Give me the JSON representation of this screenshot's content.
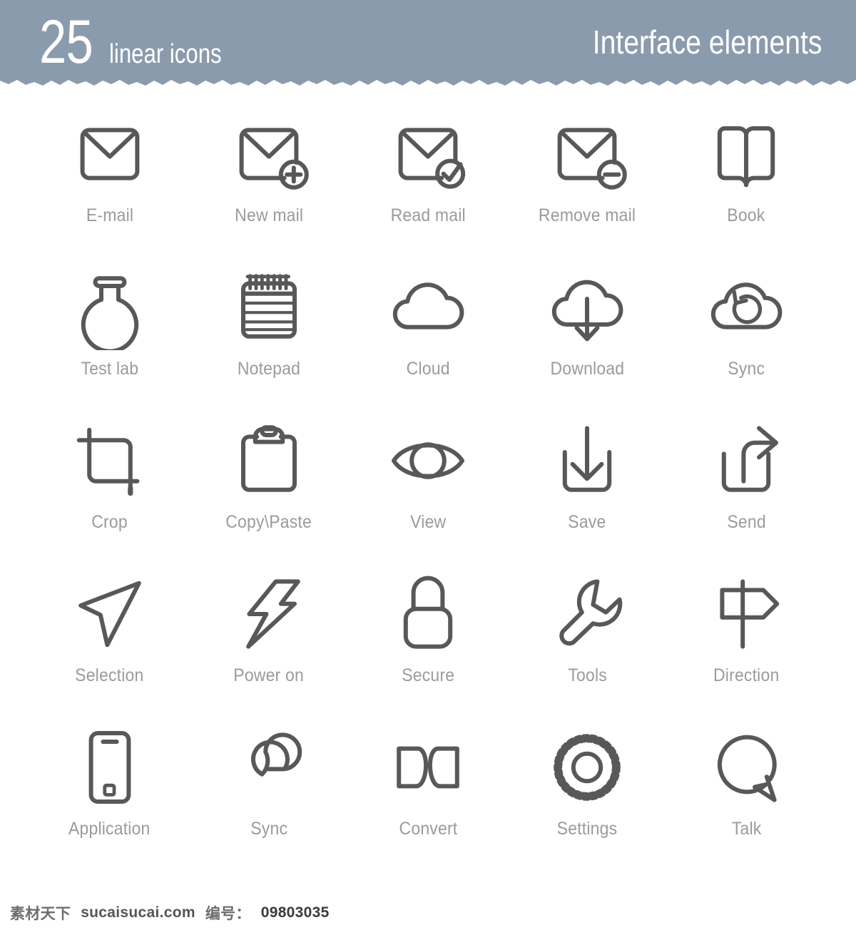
{
  "header": {
    "count": "25",
    "subtitle": "linear icons",
    "category": "Interface elements",
    "bg_color": "#8b9bae",
    "text_color": "#ffffff"
  },
  "style": {
    "icon_stroke_color": "#58585a",
    "label_color": "#9b9b9b",
    "page_background": "#ffffff"
  },
  "icons": [
    {
      "icon": "envelope-icon",
      "label": "E-mail"
    },
    {
      "icon": "envelope-plus-icon",
      "label": "New mail"
    },
    {
      "icon": "envelope-check-icon",
      "label": "Read mail"
    },
    {
      "icon": "envelope-minus-icon",
      "label": "Remove mail"
    },
    {
      "icon": "open-book-icon",
      "label": "Book"
    },
    {
      "icon": "flask-icon",
      "label": "Test lab"
    },
    {
      "icon": "notepad-icon",
      "label": "Notepad"
    },
    {
      "icon": "cloud-icon",
      "label": "Cloud"
    },
    {
      "icon": "cloud-download-icon",
      "label": "Download"
    },
    {
      "icon": "cloud-sync-icon",
      "label": "Sync"
    },
    {
      "icon": "crop-icon",
      "label": "Crop"
    },
    {
      "icon": "clipboard-icon",
      "label": "Copy\\Paste"
    },
    {
      "icon": "eye-icon",
      "label": "View"
    },
    {
      "icon": "save-tray-arrow-icon",
      "label": "Save"
    },
    {
      "icon": "send-share-icon",
      "label": "Send"
    },
    {
      "icon": "cursor-arrow-icon",
      "label": "Selection"
    },
    {
      "icon": "lightning-bolt-icon",
      "label": "Power on"
    },
    {
      "icon": "padlock-icon",
      "label": "Secure"
    },
    {
      "icon": "wrench-icon",
      "label": "Tools"
    },
    {
      "icon": "signpost-icon",
      "label": "Direction"
    },
    {
      "icon": "smartphone-icon",
      "label": "Application"
    },
    {
      "icon": "infinity-loop-icon",
      "label": "Sync"
    },
    {
      "icon": "convert-bowtie-icon",
      "label": "Convert"
    },
    {
      "icon": "gear-icon",
      "label": "Settings"
    },
    {
      "icon": "speech-bubble-icon",
      "label": "Talk"
    }
  ],
  "footer": {
    "site_name": "素材天下",
    "site_url": "sucaisucai.com",
    "id_label": "编号：",
    "id_value": "09803035"
  }
}
